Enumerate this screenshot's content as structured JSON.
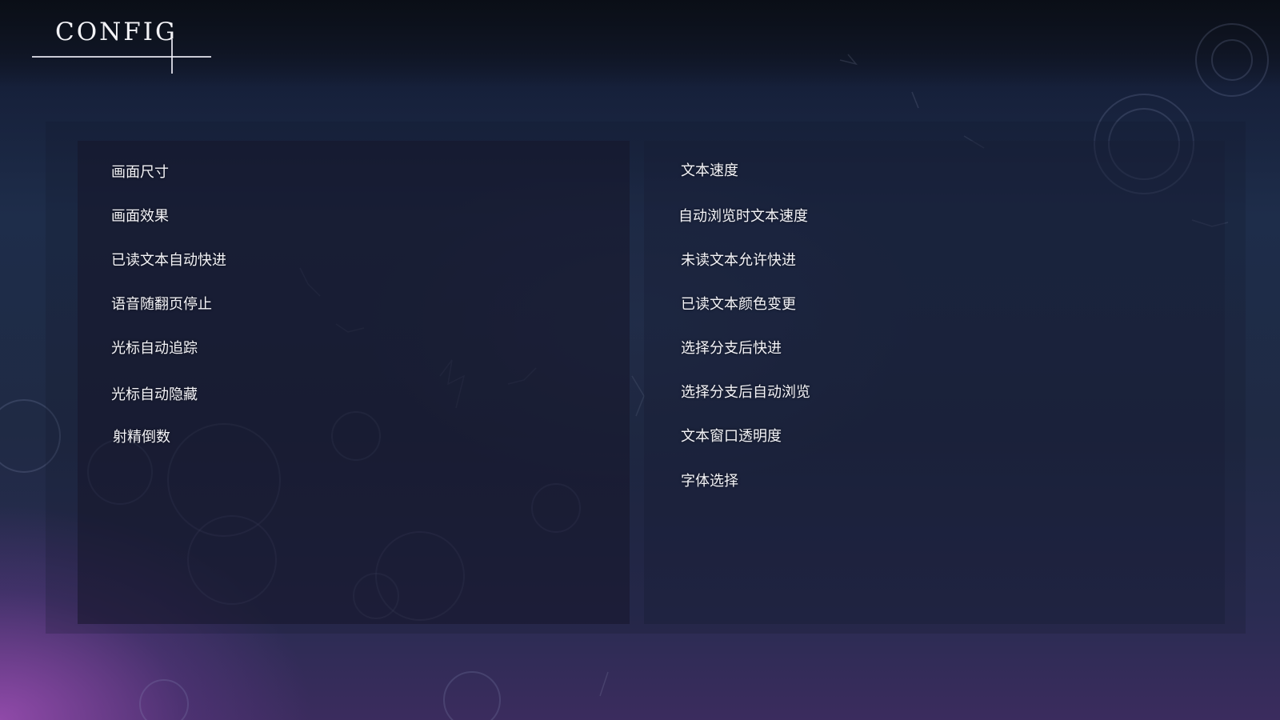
{
  "header": {
    "title": "CONFIG"
  },
  "colors": {
    "background_top": "#0f1522",
    "background_mid": "#1e2d4a",
    "accent_purple": "#a852be",
    "text": "#f4f4f8"
  },
  "left_options": [
    {
      "label": "画面尺寸"
    },
    {
      "label": "画面效果"
    },
    {
      "label": "已读文本自动快进"
    },
    {
      "label": "语音随翻页停止"
    },
    {
      "label": "光标自动追踪"
    },
    {
      "label": "光标自动隐藏"
    },
    {
      "label": "射精倒数"
    }
  ],
  "right_options": [
    {
      "label": "文本速度"
    },
    {
      "label": "自动浏览时文本速度"
    },
    {
      "label": "未读文本允许快进"
    },
    {
      "label": "已读文本颜色变更"
    },
    {
      "label": "选择分支后快进"
    },
    {
      "label": "选择分支后自动浏览"
    },
    {
      "label": "文本窗口透明度"
    },
    {
      "label": "字体选择"
    }
  ]
}
